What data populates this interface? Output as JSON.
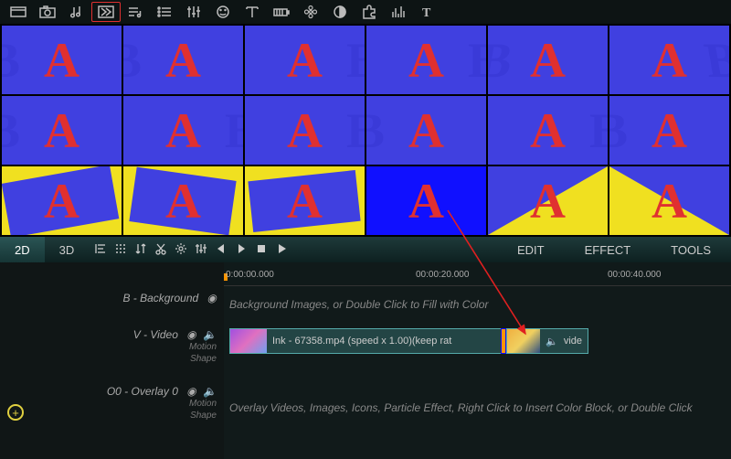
{
  "top_toolbar": {
    "icons": [
      "frame",
      "camera",
      "music",
      "transition",
      "playlist",
      "list",
      "tune",
      "smiley",
      "text-t",
      "battery",
      "flower",
      "contrast",
      "puzzle",
      "equalizer",
      "type"
    ],
    "selected_index": 3
  },
  "transitions": {
    "rows": 3,
    "cols": 6,
    "selected_row": 2,
    "selected_col": 3
  },
  "panel_bar": {
    "tabs": [
      {
        "label": "2D",
        "active": true
      },
      {
        "label": "3D",
        "active": false
      }
    ],
    "right_tabs": [
      {
        "label": "EDIT"
      },
      {
        "label": "EFFECT"
      },
      {
        "label": "TOOLS"
      }
    ]
  },
  "timeline": {
    "ruler": {
      "ticks": [
        "0:00:00.000",
        "00:00:20.000",
        "00:00:40.000"
      ]
    },
    "tracks": {
      "background": {
        "label": "B - Background",
        "hint": "Background Images, or Double Click to Fill with Color"
      },
      "video": {
        "label": "V - Video",
        "sub1": "Motion",
        "sub2": "Shape",
        "clip_text": "Ink - 67358.mp4  (speed x 1.00)(keep rat",
        "clip2_text": "vide"
      },
      "overlay": {
        "label": "O0 - Overlay 0",
        "sub1": "Motion",
        "sub2": "Shape",
        "hint": "Overlay Videos, Images, Icons, Particle Effect, Right Click to Insert Color Block, or Double Click"
      }
    }
  }
}
